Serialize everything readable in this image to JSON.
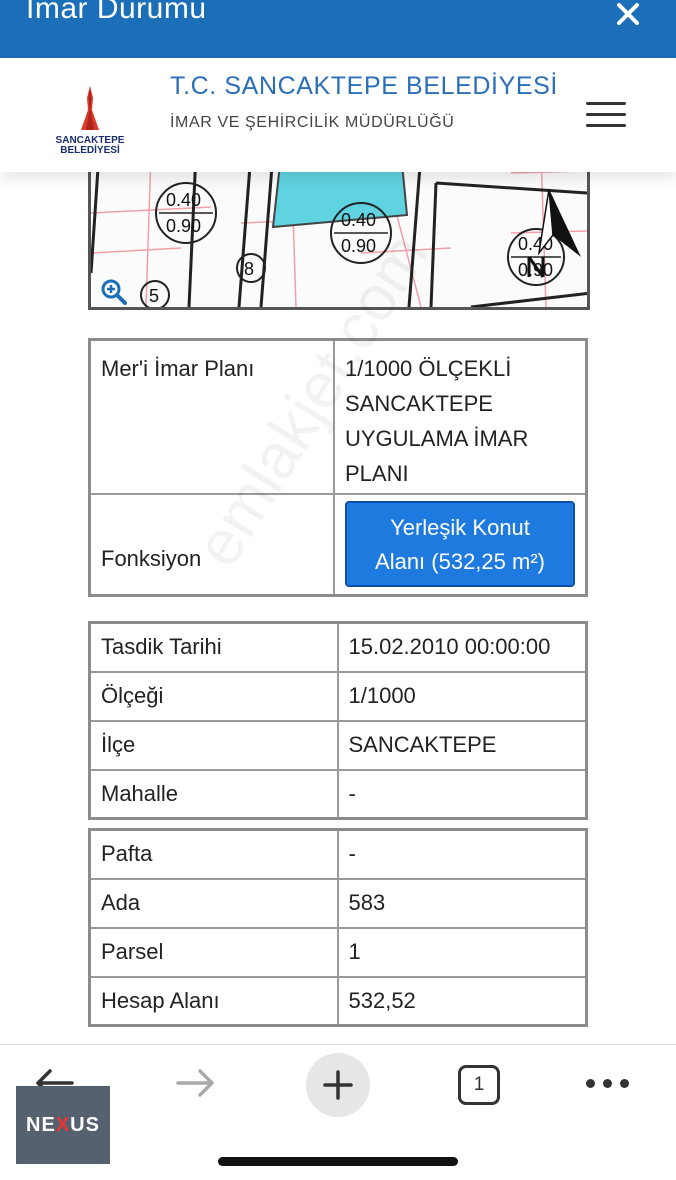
{
  "topbar": {
    "title": "İmar Durumu"
  },
  "header": {
    "logo_line1": "SANCAKTEPE",
    "logo_line2": "BELEDİYESİ",
    "org_title": "T.C. SANCAKTEPE BELEDİYESİ",
    "org_subtitle": "İMAR VE ŞEHİRCİLİK MÜDÜRLÜĞÜ"
  },
  "map": {
    "labels": [
      "0.40",
      "0.90",
      "0.40",
      "0.90",
      "0.40",
      "0.90",
      "8",
      "5"
    ],
    "parcel_color": "#5fd3e0"
  },
  "plan": {
    "label": "Mer'i İmar Planı",
    "value_lines": [
      "1/1000 ÖLÇEKLİ",
      "SANCAKTEPE",
      "UYGULAMA İMAR",
      "PLANI"
    ],
    "function_label": "Fonksiyon",
    "function_button_line1": "Yerleşik Konut",
    "function_button_line2": "Alanı (532,25 m²)"
  },
  "details": [
    {
      "label": "Tasdik Tarihi",
      "value": "15.02.2010 00:00:00"
    },
    {
      "label": "Ölçeği",
      "value": "1/1000"
    },
    {
      "label": "İlçe",
      "value": "SANCAKTEPE"
    },
    {
      "label": "Mahalle",
      "value": "-"
    }
  ],
  "parcel": [
    {
      "label": "Pafta",
      "value": "-"
    },
    {
      "label": "Ada",
      "value": "583"
    },
    {
      "label": "Parsel",
      "value": "1"
    },
    {
      "label": "Hesap Alanı",
      "value": "532,52"
    }
  ],
  "watermark": "emlakjet.com",
  "browser": {
    "tab_count": "1"
  },
  "brand_badge": {
    "part1": "NE",
    "part2": "X",
    "part3": "US"
  },
  "colors": {
    "topbar": "#1a6fb8",
    "button": "#1f7ae0",
    "title_blue": "#2a6fb8"
  }
}
